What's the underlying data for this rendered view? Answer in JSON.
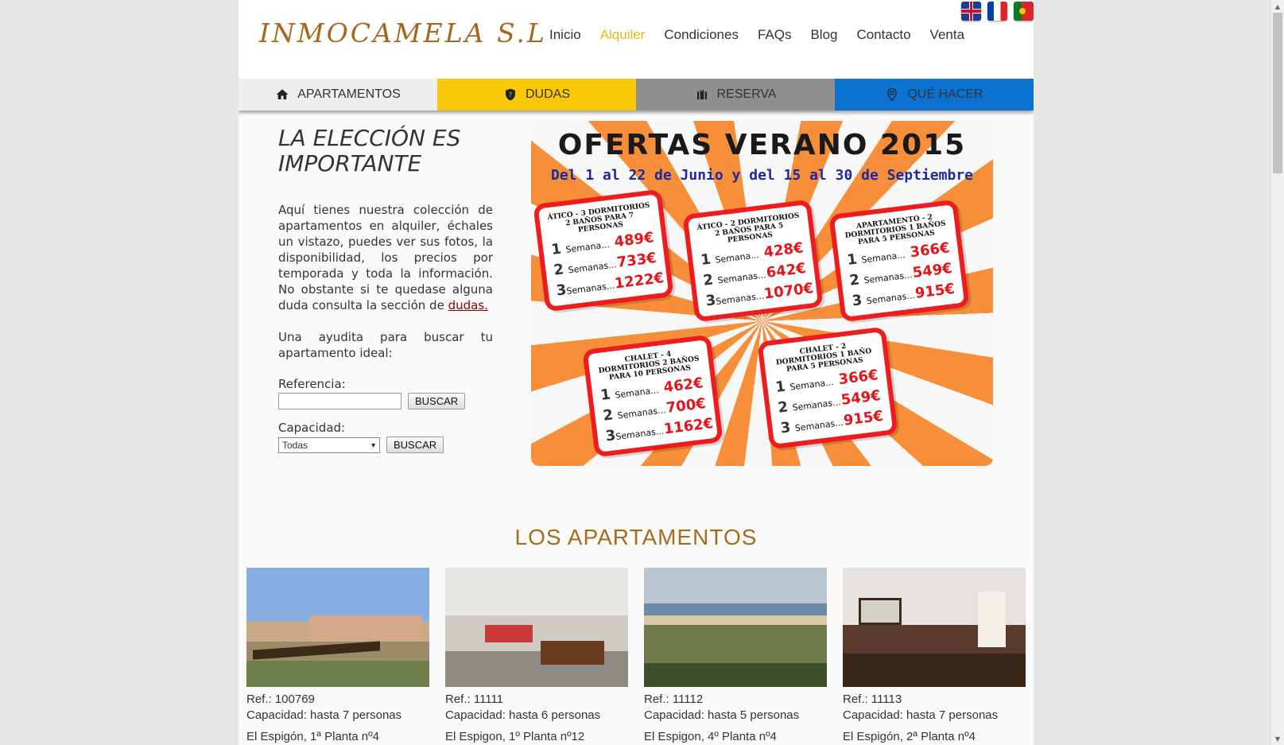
{
  "brand": {
    "logo_text": "INMOCAMELA S.L"
  },
  "languages": [
    "English",
    "Français",
    "Português"
  ],
  "nav": {
    "items": [
      "Inicio",
      "Alquiler",
      "Condiciones",
      "FAQs",
      "Blog",
      "Contacto",
      "Venta"
    ],
    "active_index": 1,
    "active_color": "#e8b810"
  },
  "tabs": [
    {
      "label": "APARTAMENTOS",
      "icon": "home-icon",
      "color": "#eeeeee"
    },
    {
      "label": "DUDAS",
      "icon": "shield-question-icon",
      "color": "#f9c909"
    },
    {
      "label": "RESERVA",
      "icon": "suitcase-icon",
      "color": "#8f8f8f"
    },
    {
      "label": "QUÉ HACER",
      "icon": "map-pin-icon",
      "color": "#0c72cf"
    }
  ],
  "intro": {
    "title": "LA ELECCIÓN ES IMPORTANTE",
    "paragraph": "Aquí tienes nuestra colección de apartamentos en alquiler, échales un vistazo, puedes ver sus fotos, la disponibilidad, los precios por temporada y toda la información. No obstante si te quedase alguna duda consulta la sección de",
    "link": "dudas.",
    "help": "Una ayudita para buscar tu apartamento ideal:"
  },
  "search": {
    "reference_label": "Referencia:",
    "reference_value": "",
    "capacity_label": "Capacidad:",
    "capacity_value": "Todas",
    "button_label": "BUSCAR"
  },
  "banner": {
    "title": "OFERTAS VERANO 2015",
    "subtitle": "Del 1 al 22 de Junio y del 15 al 30 de Septiembre",
    "offers": [
      {
        "title": "Ático - 3 dormitorios 2 baños para 7 personas",
        "rows": [
          {
            "n": "1",
            "label": "Semana...",
            "price": "489€"
          },
          {
            "n": "2",
            "label": "Semanas...",
            "price": "733€"
          },
          {
            "n": "3",
            "label": "Semanas...",
            "price": "1222€"
          }
        ]
      },
      {
        "title": "Ático - 2 dormitorios 2 baños para 5 personas",
        "rows": [
          {
            "n": "1",
            "label": "Semana...",
            "price": "428€"
          },
          {
            "n": "2",
            "label": "Semanas...",
            "price": "642€"
          },
          {
            "n": "3",
            "label": "Semanas...",
            "price": "1070€"
          }
        ]
      },
      {
        "title": "Apartamento - 2 dormitorios 1 baños para 5 personas",
        "rows": [
          {
            "n": "1",
            "label": "Semana...",
            "price": "366€"
          },
          {
            "n": "2",
            "label": "Semanas...",
            "price": "549€"
          },
          {
            "n": "3",
            "label": "Semanas...",
            "price": "915€"
          }
        ]
      },
      {
        "title": "Chalet - 4 dormitorios 2 baños para 10 personas",
        "rows": [
          {
            "n": "1",
            "label": "Semana...",
            "price": "462€"
          },
          {
            "n": "2",
            "label": "Semanas...",
            "price": "700€"
          },
          {
            "n": "3",
            "label": "Semanas...",
            "price": "1162€"
          }
        ]
      },
      {
        "title": "Chalet - 2 dormitorios 1 baño para 5 personas",
        "rows": [
          {
            "n": "1",
            "label": "Semana...",
            "price": "366€"
          },
          {
            "n": "2",
            "label": "Semanas...",
            "price": "549€"
          },
          {
            "n": "3",
            "label": "Semanas...",
            "price": "915€"
          }
        ]
      }
    ]
  },
  "apartments": {
    "section_title": "LOS APARTAMENTOS",
    "items": [
      {
        "ref": "Ref.: 100769",
        "capacity": "Capacidad: hasta 7 personas",
        "address": "El Espigón, 1ª Planta nº4"
      },
      {
        "ref": "Ref.: 11111",
        "capacity": "Capacidad: hasta 6 personas",
        "address": "El Espigon, 1º Planta nº12"
      },
      {
        "ref": "Ref.: 11112",
        "capacity": "Capacidad: hasta 5 personas",
        "address": "El Espigon, 4º Planta nº4"
      },
      {
        "ref": "Ref.: 11113",
        "capacity": "Capacidad: hasta 7 personas",
        "address": "El Espigón, 2ª Planta nº4"
      }
    ]
  }
}
